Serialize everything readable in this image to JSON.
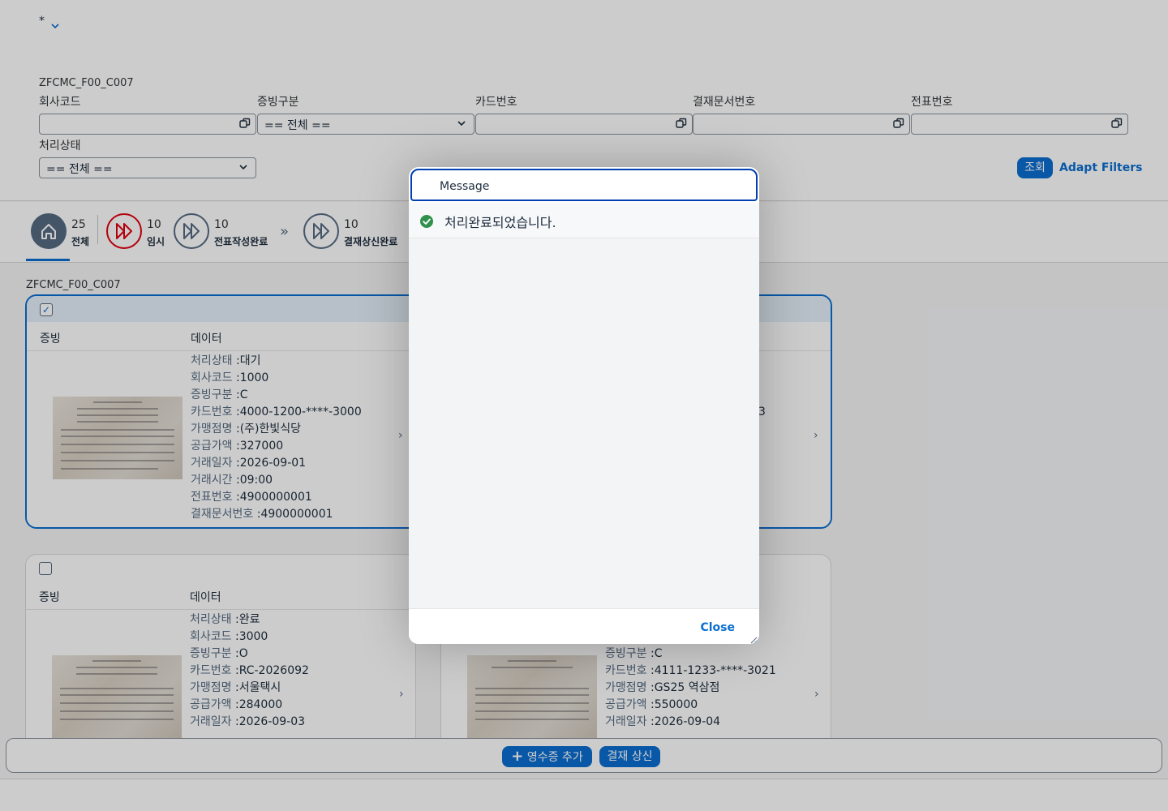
{
  "variant": {
    "label": "*"
  },
  "filterbar": {
    "title": "ZFCMC_F00_C007",
    "fields": [
      {
        "label": "회사코드",
        "value": ""
      },
      {
        "label": "증빙구분",
        "value": "== 전체 =="
      },
      {
        "label": "카드번호",
        "value": ""
      },
      {
        "label": "결재문서번호",
        "value": ""
      },
      {
        "label": "전표번호",
        "value": ""
      },
      {
        "label": "처리상태",
        "value": "== 전체 =="
      }
    ],
    "go_label": "조회",
    "adapt_label": "Adapt Filters"
  },
  "tabs": [
    {
      "count": "25",
      "label": "전체"
    },
    {
      "count": "10",
      "label": "임시"
    },
    {
      "count": "10",
      "label": "전표작성완료"
    },
    {
      "count": "10",
      "label": "결재상신완료"
    }
  ],
  "content": {
    "title": "ZFCMC_F00_C007",
    "col_evidence": "증빙",
    "col_data": "데이터",
    "cards": [
      {
        "checked": "✓",
        "fields": [
          {
            "k": "처리상태",
            "v": "대기"
          },
          {
            "k": "회사코드",
            "v": "1000"
          },
          {
            "k": "증빙구분",
            "v": "C"
          },
          {
            "k": "카드번호",
            "v": "4000-1200-****-3000"
          },
          {
            "k": "가맹점명",
            "v": "(주)한빛식당"
          },
          {
            "k": "공급가액",
            "v": "327000"
          },
          {
            "k": "거래일자",
            "v": "2026-09-01"
          },
          {
            "k": "거래시간",
            "v": "09:00"
          },
          {
            "k": "전표번호",
            "v": "4900000001"
          },
          {
            "k": "결재문서번호",
            "v": "4900000001"
          }
        ]
      },
      {
        "partial_value": "3"
      },
      {
        "checked": "",
        "fields": [
          {
            "k": "처리상태",
            "v": "완료"
          },
          {
            "k": "회사코드",
            "v": "3000"
          },
          {
            "k": "증빙구분",
            "v": "O"
          },
          {
            "k": "카드번호",
            "v": "RC-2026092"
          },
          {
            "k": "가맹점명",
            "v": "서울택시"
          },
          {
            "k": "공급가액",
            "v": "284000"
          },
          {
            "k": "거래일자",
            "v": "2026-09-03"
          }
        ]
      },
      {
        "fields": [
          {
            "k": "증빙구분",
            "v": "C"
          },
          {
            "k": "카드번호",
            "v": "4111-1233-****-3021"
          },
          {
            "k": "가맹점명",
            "v": "GS25 역삼점"
          },
          {
            "k": "공급가액",
            "v": "550000"
          },
          {
            "k": "거래일자",
            "v": "2026-09-04"
          }
        ]
      }
    ]
  },
  "footer": {
    "add_label": "영수증 추가",
    "submit_label": "결재 상신"
  },
  "dialog": {
    "title": "Message",
    "message": "처리완료되었습니다.",
    "close_label": "Close"
  },
  "colors": {
    "accent": "#0a6ed1",
    "error": "#e2000f",
    "success": "#30914c",
    "neutral": "#556b82"
  }
}
